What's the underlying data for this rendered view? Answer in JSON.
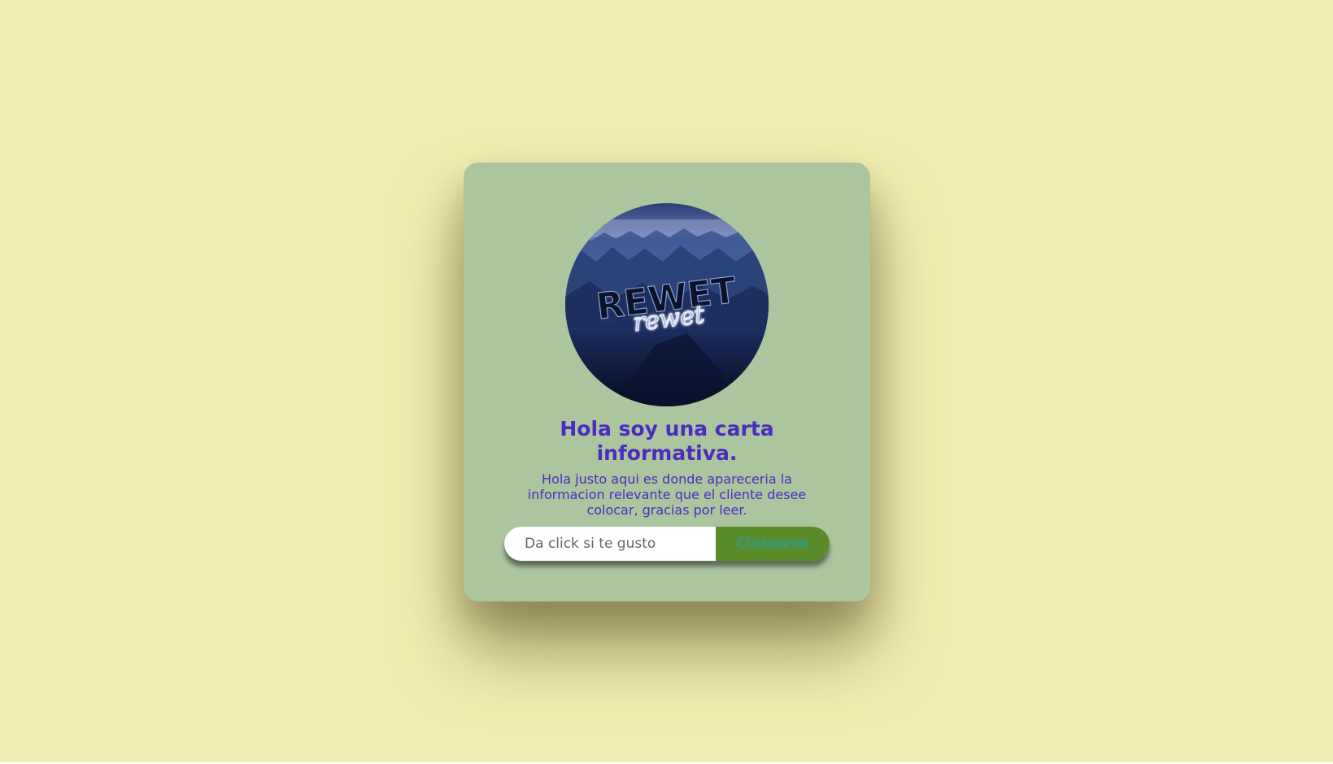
{
  "card": {
    "logo_text_main": "REWET",
    "logo_text_script": "rewet",
    "title": "Hola soy una carta informativa.",
    "description": "Hola justo aqui es donde apareceria la informacion relevante que el cliente desee colocar, gracias por leer.",
    "input_placeholder": "Da click si te gusto",
    "button_label": "Clickeame"
  },
  "colors": {
    "page_background": "#f2eeb3",
    "card_background": "#abc59f",
    "text_accent": "#4a2dbf",
    "button_background": "#5a8c2c",
    "button_text": "#1aa3b3"
  }
}
